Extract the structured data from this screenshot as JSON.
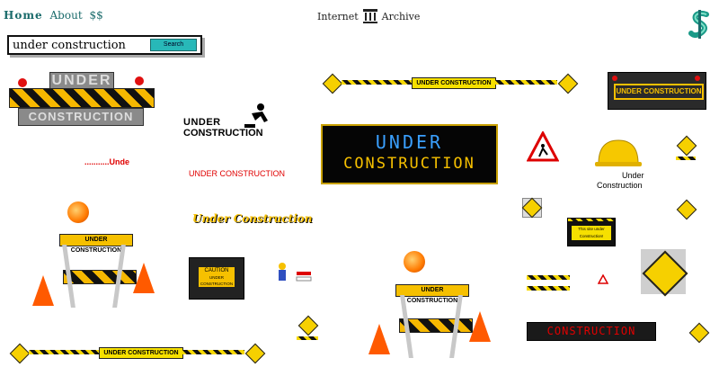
{
  "nav": {
    "home": "Home",
    "about": "About",
    "dollar": "$$",
    "internet": "Internet",
    "archive": "Archive"
  },
  "search": {
    "query": "under construction",
    "button": "Search"
  },
  "gifs": {
    "under_big_top": "UNDER",
    "construction_big": "CONSTRUCTION",
    "banner_top": "UNDER CONSTRUCTION",
    "dark_box": "UNDER CONSTRUCTION",
    "worker_title_1": "UNDER",
    "worker_title_2": "CONSTRUCTION",
    "dots_text": "...........Unde",
    "red_text": "UNDER CONSTRUCTION",
    "led_1": "UNDER",
    "led_2": "CONSTRUCTION",
    "helmet_1": "Under",
    "helmet_2": "Construction",
    "script_text": "Under Construction",
    "barrier_sign_left": "UNDER CONSTRUCTION",
    "caution_top": "CAUTION",
    "caution_body": "UNDER CONSTRUCTION",
    "site_box": "This site under Construction!",
    "barrier_sign_mid": "UNDER CONSTRUCTION",
    "red_led": "CONSTRUCTION",
    "bottom_banner": "UNDER CONSTRUCTION"
  },
  "colors": {
    "accent_teal": "#1a6b6b",
    "hazard_yellow": "#f6d000",
    "cone_orange": "#ff5a00",
    "red_text": "#e00000"
  },
  "icons": [
    "temple-icon",
    "dollar-spinner-icon",
    "warning-sign-icon",
    "hard-hat-icon",
    "worker-icon",
    "cone-icon",
    "beacon-icon"
  ]
}
